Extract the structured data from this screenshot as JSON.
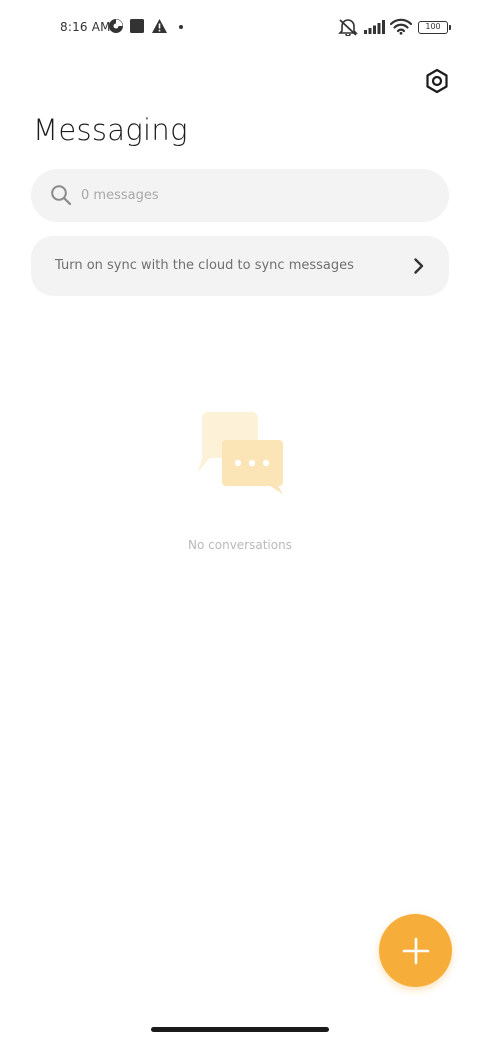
{
  "status_bar": {
    "time": "8:16 AM",
    "battery": "100",
    "icons": [
      "data-saver-icon",
      "square-notification-icon",
      "warning-icon",
      "dot-icon",
      "muted-icon",
      "signal-icon",
      "wifi-icon",
      "battery-icon"
    ]
  },
  "header": {
    "title": "Messaging",
    "settings_icon": "settings-hexagon-icon"
  },
  "search": {
    "placeholder": "0 messages",
    "value": "",
    "icon": "search-icon"
  },
  "sync_banner": {
    "text": "Turn on sync with the cloud to sync messages",
    "icon": "chevron-right-icon"
  },
  "empty_state": {
    "text": "No conversations",
    "icon": "chat-bubbles-icon"
  },
  "fab": {
    "icon": "plus-icon"
  },
  "colors": {
    "accent": "#f6ad3a",
    "surface": "#f3f3f3",
    "illustration_light": "#fdf1d8",
    "illustration_dark": "#fbe4b6"
  }
}
